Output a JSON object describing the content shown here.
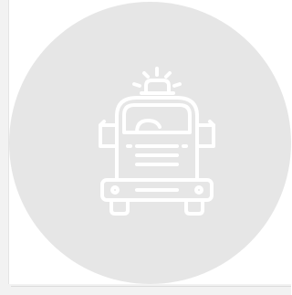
{
  "badge": {
    "background_color": "#e6e6e6",
    "icon_color": "#ffffff",
    "icon": "fire-truck-with-siren-icon"
  },
  "frame": {
    "panel_color": "#f2f2f2"
  }
}
